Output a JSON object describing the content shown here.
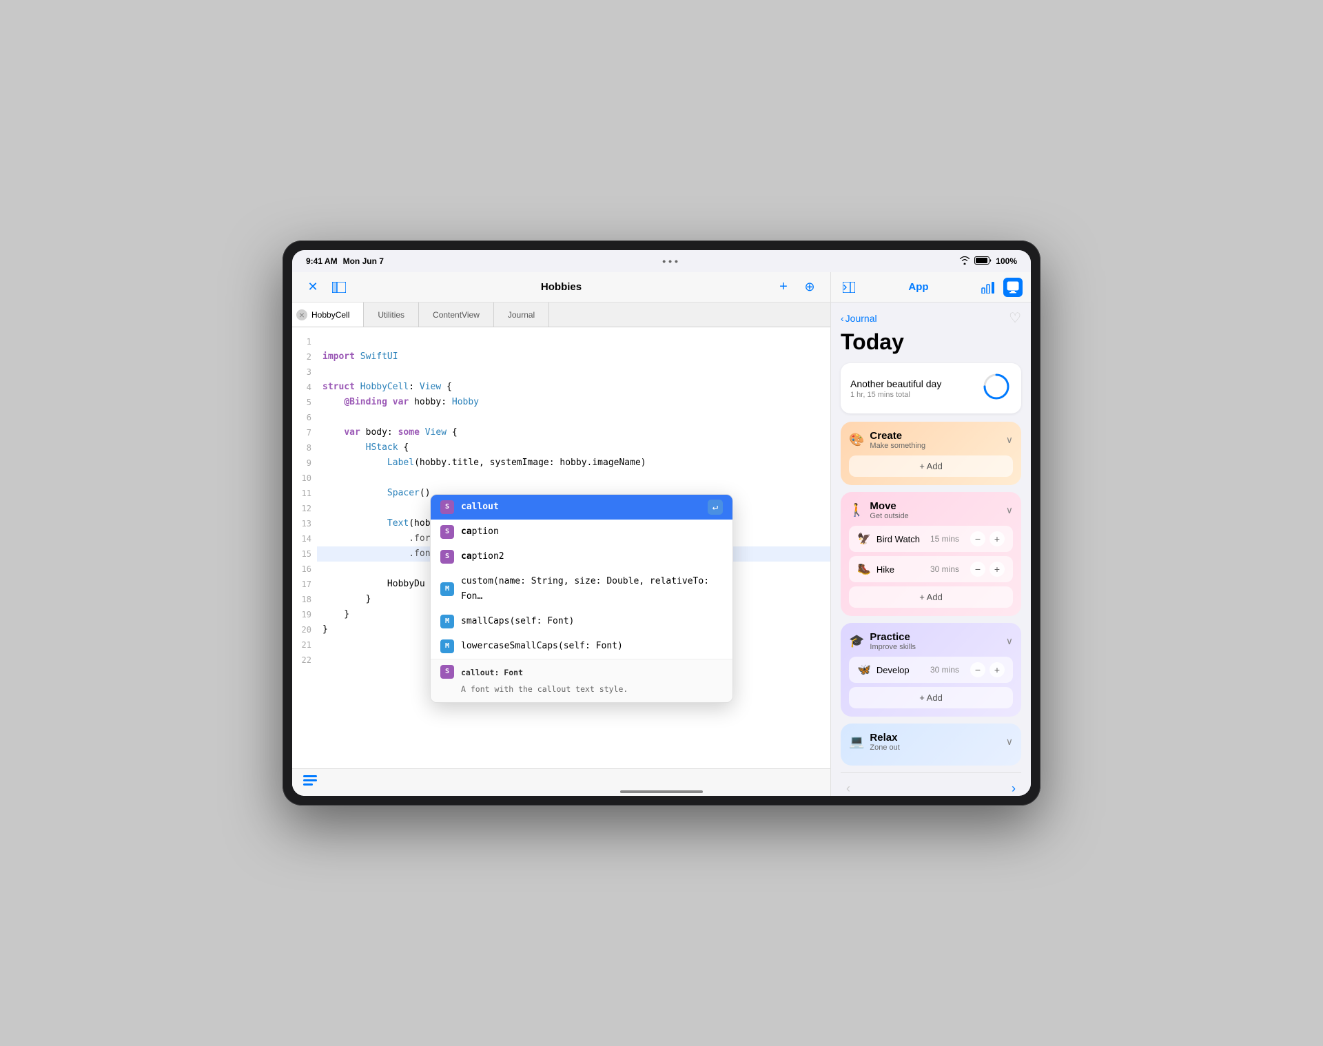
{
  "device": {
    "time": "9:41 AM",
    "date": "Mon Jun 7",
    "battery": "100%",
    "wifi": true
  },
  "editor": {
    "title": "Hobbies",
    "tabs": [
      {
        "id": "hobby-cell",
        "label": "HobbyCell",
        "active": true,
        "closeable": true
      },
      {
        "id": "utilities",
        "label": "Utilities",
        "active": false
      },
      {
        "id": "content-view",
        "label": "ContentView",
        "active": false
      },
      {
        "id": "journal",
        "label": "Journal",
        "active": false
      }
    ],
    "lines": [
      {
        "num": 1,
        "code": ""
      },
      {
        "num": 2,
        "code": "import SwiftUI"
      },
      {
        "num": 3,
        "code": ""
      },
      {
        "num": 4,
        "code": "struct HobbyCell: View {"
      },
      {
        "num": 5,
        "code": "    @Binding var hobby: Hobby"
      },
      {
        "num": 6,
        "code": ""
      },
      {
        "num": 7,
        "code": "    var body: some View {"
      },
      {
        "num": 8,
        "code": "        HStack {"
      },
      {
        "num": 9,
        "code": "            Label(hobby.title, systemImage: hobby.imageName)"
      },
      {
        "num": 10,
        "code": ""
      },
      {
        "num": 11,
        "code": "            Spacer()"
      },
      {
        "num": 12,
        "code": ""
      },
      {
        "num": 13,
        "code": "            Text(hobby.duration.formatted())"
      },
      {
        "num": 14,
        "code": "                .foregroundStyle(.tertiary)"
      },
      {
        "num": 15,
        "code": "                .font(.ca",
        "highlight": true
      },
      {
        "num": 16,
        "code": ""
      },
      {
        "num": 17,
        "code": "            HobbyDu"
      },
      {
        "num": 18,
        "code": "        }"
      },
      {
        "num": 19,
        "code": "    }"
      },
      {
        "num": 20,
        "code": "}"
      },
      {
        "num": 21,
        "code": ""
      },
      {
        "num": 22,
        "code": ""
      }
    ],
    "autocomplete": {
      "items": [
        {
          "type": "S",
          "text": "callout",
          "selected": true,
          "hasReturn": true
        },
        {
          "type": "S",
          "text": "caption",
          "selected": false
        },
        {
          "type": "S",
          "text": "caption2",
          "selected": false
        },
        {
          "type": "M",
          "text": "custom(name: String, size: Double, relativeTo: Fon…",
          "selected": false
        },
        {
          "type": "M",
          "text": "smallCaps(self: Font)",
          "selected": false
        },
        {
          "type": "M",
          "text": "lowercaseSmallCaps(self: Font)",
          "selected": false
        }
      ],
      "footer": {
        "type": "S",
        "title": "callout: Font",
        "description": "A font with the callout text style."
      }
    }
  },
  "right_panel": {
    "toolbar": {
      "back_label": "◀",
      "app_label": "App",
      "icon_bar": "📊",
      "icon_settings": "⚙"
    },
    "journal": {
      "back_text": "Journal",
      "title": "Today",
      "today_card": {
        "title": "Another beautiful day",
        "subtitle": "1 hr, 15 mins total",
        "progress": 75
      },
      "sections": [
        {
          "id": "create",
          "icon": "🎨",
          "title": "Create",
          "subtitle": "Make something",
          "color_class": "create",
          "items": [
            {
              "icon": "",
              "name": "",
              "time": "",
              "empty": true
            }
          ],
          "add_label": "+ Add"
        },
        {
          "id": "move",
          "icon": "🚶",
          "title": "Move",
          "subtitle": "Get outside",
          "color_class": "move",
          "items": [
            {
              "icon": "🦅",
              "name": "Bird Watch",
              "time": "15 mins"
            },
            {
              "icon": "🥾",
              "name": "Hike",
              "time": "30 mins"
            }
          ],
          "add_label": "+ Add"
        },
        {
          "id": "practice",
          "icon": "🎓",
          "title": "Practice",
          "subtitle": "Improve skills",
          "color_class": "practice",
          "items": [
            {
              "icon": "🦋",
              "name": "Develop",
              "time": "30 mins"
            }
          ],
          "add_label": "+ Add"
        },
        {
          "id": "relax",
          "icon": "💻",
          "title": "Relax",
          "subtitle": "Zone out",
          "color_class": "relax",
          "items": []
        }
      ]
    }
  },
  "bottom": {
    "list_icon": "list"
  }
}
